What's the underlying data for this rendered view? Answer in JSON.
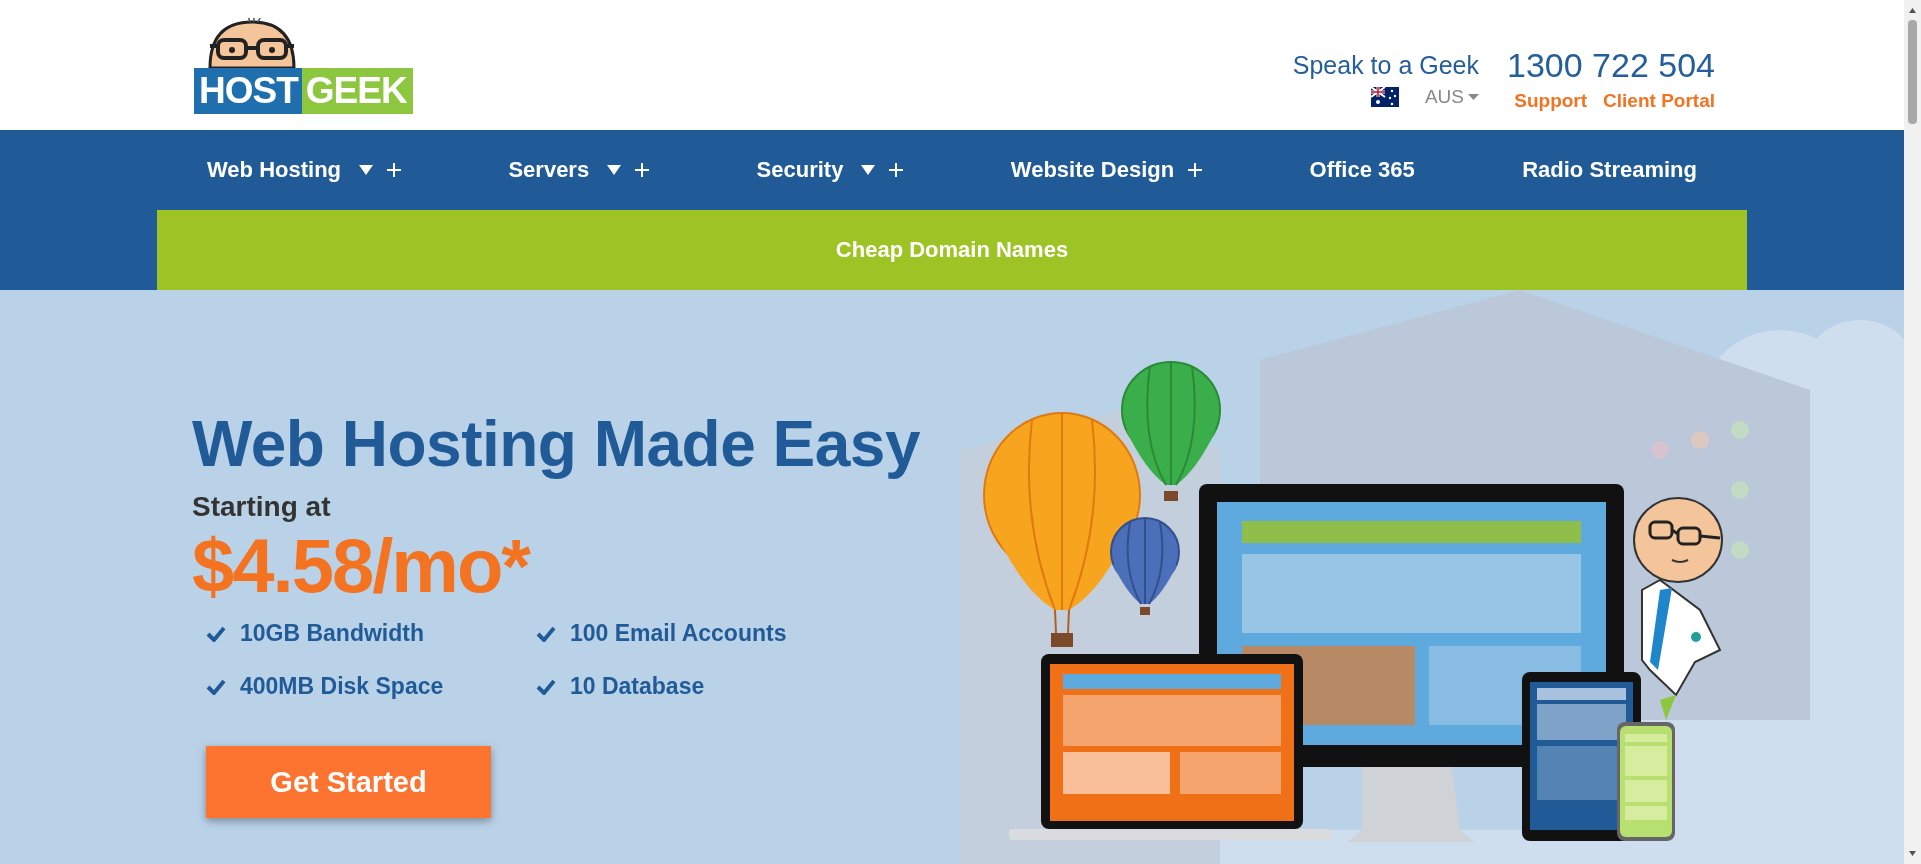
{
  "header": {
    "logo": {
      "host": "HOST",
      "geek": "GEEK"
    },
    "contact_label": "Speak to a Geek",
    "phone": "1300 722 504",
    "region": {
      "label": "AUS"
    },
    "links": [
      "Support",
      "Client Portal"
    ]
  },
  "nav": {
    "items": [
      {
        "label": "Web Hosting",
        "dropdown": true,
        "expandable": true
      },
      {
        "label": "Servers",
        "dropdown": true,
        "expandable": true
      },
      {
        "label": "Security",
        "dropdown": true,
        "expandable": true
      },
      {
        "label": "Website Design",
        "dropdown": false,
        "expandable": true
      },
      {
        "label": "Office 365",
        "dropdown": false,
        "expandable": false
      },
      {
        "label": "Radio Streaming",
        "dropdown": false,
        "expandable": false
      }
    ],
    "sub_items": [
      "Cheap Domain Names"
    ]
  },
  "hero": {
    "title": "Web Hosting Made Easy",
    "subtitle": "Starting at",
    "price": "$4.58/mo*",
    "features": [
      "10GB Bandwidth",
      "100 Email Accounts",
      "400MB Disk Space",
      "10 Database"
    ],
    "button": "Get Started"
  }
}
